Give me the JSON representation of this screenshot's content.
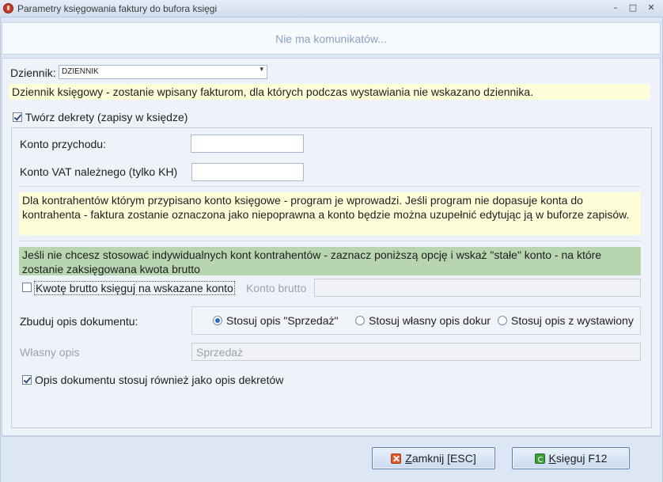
{
  "window": {
    "title": "Parametry księgowania faktury do bufora księgi",
    "min_glyph": "–",
    "max_glyph": "□",
    "close_glyph": "✕"
  },
  "messages": {
    "text": "Nie ma komunikatów..."
  },
  "journal": {
    "label": "Dziennik:",
    "value": "DZIENNIK",
    "arrow": "▾",
    "note": "Dziennik księgowy - zostanie wpisany fakturom, dla których podczas wystawiania nie wskazano dziennika."
  },
  "create_entries": {
    "label": "Twórz dekrety (zapisy w księdze)",
    "checked": true
  },
  "accounts": {
    "income_label": "Konto przychodu:",
    "income_value": "",
    "vat_label": "Konto VAT należnego (tylko KH)",
    "vat_value": "",
    "info_yellow": "Dla kontrahentów którym przypisano konto księgowe - program je wprowadzi. Jeśli program nie dopasuje konta do kontrahenta - faktura zostanie oznaczona jako niepoprawna a konto będzie można uzupełnić edytując ją w buforze zapisów.",
    "info_green": "Jeśli nie chcesz stosować indywidualnych kont kontrahentów - zaznacz poniższą opcję i wskaż \"stałe\" konto - na które zostanie zaksięgowana kwota brutto",
    "gross_checkbox_label": "Kwotę brutto księguj na wskazane konto",
    "gross_checked": false,
    "gross_account_label": "Konto brutto",
    "gross_account_value": ""
  },
  "description": {
    "label": "Zbuduj opis dokumentu:",
    "options": [
      {
        "label": "Stosuj opis \"Sprzedaż\"",
        "checked": true
      },
      {
        "label": "Stosuj własny opis dokur",
        "checked": false
      },
      {
        "label": "Stosuj opis z wystawiony",
        "checked": false
      }
    ],
    "own_label": "Własny opis",
    "own_value": "Sprzedaż",
    "apply_label": "Opis dokumentu stosuj również jako opis dekretów",
    "apply_checked": true
  },
  "buttons": {
    "close": "Zamknij [ESC]",
    "post": "Księguj F12"
  },
  "colors": {
    "accent": "#2e6bc4",
    "note_yellow": "#fefed8",
    "note_green": "#b7d6b0"
  }
}
